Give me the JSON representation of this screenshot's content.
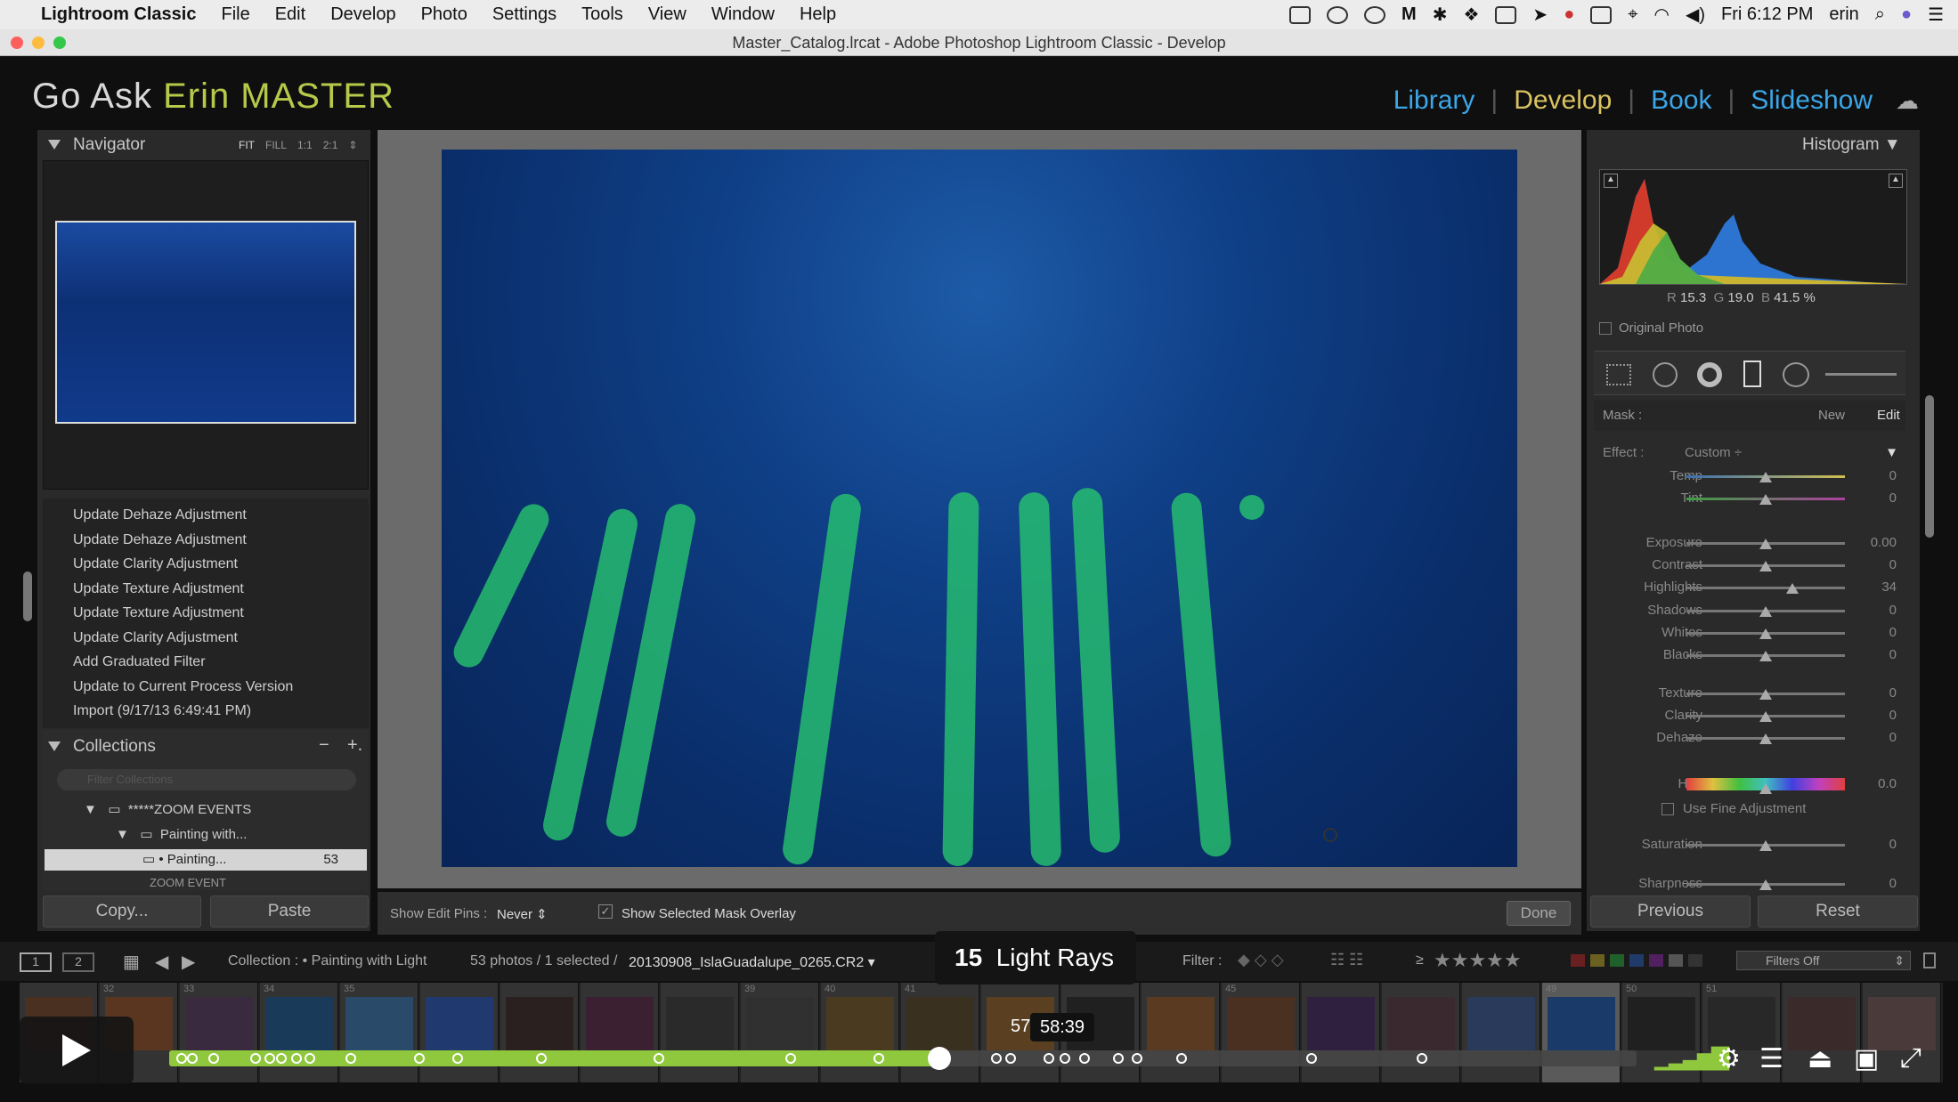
{
  "menubar": {
    "app_name": "Lightroom Classic",
    "items": [
      "File",
      "Edit",
      "Develop",
      "Photo",
      "Settings",
      "Tools",
      "View",
      "Window",
      "Help"
    ],
    "clock": "Fri 6:12 PM",
    "user": "erin"
  },
  "window": {
    "title": "Master_Catalog.lrcat - Adobe Photoshop Lightroom Classic - Develop"
  },
  "identity_plate": {
    "part1": "Go Ask ",
    "part2": "Erin MASTER"
  },
  "modules": {
    "library": "Library",
    "develop": "Develop",
    "book": "Book",
    "slideshow": "Slideshow"
  },
  "navigator": {
    "title": "Navigator",
    "zoom_fit": "FIT",
    "zoom_fill": "FILL",
    "zoom_1_1": "1:1",
    "zoom_2_1": "2:1"
  },
  "history": [
    "Update Dehaze Adjustment",
    "Update Dehaze Adjustment",
    "Update Clarity Adjustment",
    "Update Texture Adjustment",
    "Update Texture Adjustment",
    "Update Clarity Adjustment",
    "Add Graduated Filter",
    "Update to Current Process Version",
    "Import (9/17/13 6:49:41 PM)"
  ],
  "collections": {
    "title": "Collections",
    "minus": "−",
    "plus": "+.",
    "filter_placeholder": "Filter Collections",
    "set1": "*****ZOOM EVENTS",
    "set2": "Painting with...",
    "selected": "• Painting...",
    "selected_count": "53",
    "set3": "ZOOM EVENT"
  },
  "left_buttons": {
    "copy": "Copy...",
    "paste": "Paste"
  },
  "toolbar": {
    "edit_pins_label": "Show Edit Pins :",
    "edit_pins_value": "Never",
    "mask_overlay_label": "Show Selected Mask Overlay",
    "done": "Done"
  },
  "histogram": {
    "title": "Histogram",
    "r_label": "R",
    "r_value": "15.3",
    "g_label": "G",
    "g_value": "19.0",
    "b_label": "B",
    "b_value": "41.5 %",
    "original_photo": "Original Photo"
  },
  "mask": {
    "label": "Mask :",
    "new": "New",
    "edit": "Edit"
  },
  "effect": {
    "label": "Effect :",
    "value": "Custom"
  },
  "sliders": [
    {
      "label": "Temp",
      "value": "0",
      "pos": 0.5
    },
    {
      "label": "Tint",
      "value": "0",
      "pos": 0.5
    },
    {
      "label": "Exposure",
      "value": "0.00",
      "pos": 0.5
    },
    {
      "label": "Contrast",
      "value": "0",
      "pos": 0.5
    },
    {
      "label": "Highlights",
      "value": "34",
      "pos": 0.67
    },
    {
      "label": "Shadows",
      "value": "0",
      "pos": 0.5
    },
    {
      "label": "Whites",
      "value": "0",
      "pos": 0.5
    },
    {
      "label": "Blacks",
      "value": "0",
      "pos": 0.5
    },
    {
      "label": "Texture",
      "value": "0",
      "pos": 0.5
    },
    {
      "label": "Clarity",
      "value": "0",
      "pos": 0.5
    },
    {
      "label": "Dehaze",
      "value": "0",
      "pos": 0.5
    },
    {
      "label": "Hue",
      "value": "0.0",
      "pos": 0.5
    },
    {
      "label": "Saturation",
      "value": "0",
      "pos": 0.5
    },
    {
      "label": "Sharpness",
      "value": "0",
      "pos": 0.5
    }
  ],
  "fine_adjust": "Use Fine Adjustment",
  "right_buttons": {
    "previous": "Previous",
    "reset": "Reset"
  },
  "filmbar": {
    "page1": "1",
    "page2": "2",
    "collection_label": "Collection : • Painting with Light",
    "count": "53 photos / 1 selected /",
    "filename": "20130908_IslaGuadalupe_0265.CR2",
    "filter_label": "Filter :",
    "rating_op": "≥",
    "filters_off": "Filters Off"
  },
  "film_numbers": [
    "",
    "32",
    "33",
    "34",
    "35",
    "",
    "",
    "",
    "",
    "39",
    "40",
    "41",
    "",
    "",
    "",
    "45",
    "",
    "",
    "",
    "49",
    "50",
    "51",
    "",
    ""
  ],
  "video": {
    "chapter_number": "15",
    "chapter_title": "Light Rays",
    "time_tooltip": "58:39",
    "elapsed_partial": "57",
    "progress": 0.525
  },
  "colors": {
    "accent_develop": "#d9c262",
    "module_link": "#3ba6e8",
    "progress": "#8fc83c"
  }
}
